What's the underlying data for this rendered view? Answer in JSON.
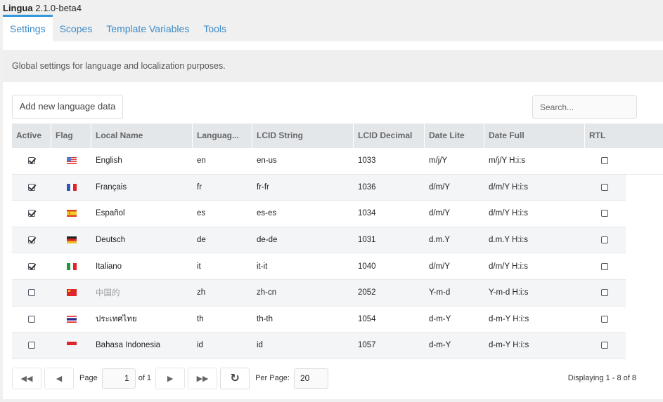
{
  "app": {
    "name": "Lingua",
    "version": "2.1.0-beta4"
  },
  "tabs": [
    {
      "label": "Settings",
      "active": true
    },
    {
      "label": "Scopes",
      "active": false
    },
    {
      "label": "Template Variables",
      "active": false
    },
    {
      "label": "Tools",
      "active": false
    }
  ],
  "description": "Global settings for language and localization purposes.",
  "toolbar": {
    "add_label": "Add new language data",
    "search_placeholder": "Search..."
  },
  "grid": {
    "columns": [
      "Active",
      "Flag",
      "Local Name",
      "Languag...",
      "LCID String",
      "LCID Decimal",
      "Date Lite",
      "Date Full",
      "RTL"
    ],
    "rows": [
      {
        "active": true,
        "flag": "us-flag-icon",
        "local_name": "English",
        "lang": "en",
        "lcid_string": "en-us",
        "lcid_decimal": "1033",
        "date_lite": "m/j/Y",
        "date_full": "m/j/Y H:i:s",
        "rtl": false
      },
      {
        "active": true,
        "flag": "fr-flag-icon",
        "local_name": "Français",
        "lang": "fr",
        "lcid_string": "fr-fr",
        "lcid_decimal": "1036",
        "date_lite": "d/m/Y",
        "date_full": "d/m/Y H:i:s",
        "rtl": false
      },
      {
        "active": true,
        "flag": "es-flag-icon",
        "local_name": "Español",
        "lang": "es",
        "lcid_string": "es-es",
        "lcid_decimal": "1034",
        "date_lite": "d/m/Y",
        "date_full": "d/m/Y H:i:s",
        "rtl": false
      },
      {
        "active": true,
        "flag": "de-flag-icon",
        "local_name": "Deutsch",
        "lang": "de",
        "lcid_string": "de-de",
        "lcid_decimal": "1031",
        "date_lite": "d.m.Y",
        "date_full": "d.m.Y H:i:s",
        "rtl": false
      },
      {
        "active": true,
        "flag": "it-flag-icon",
        "local_name": "Italiano",
        "lang": "it",
        "lcid_string": "it-it",
        "lcid_decimal": "1040",
        "date_lite": "d/m/Y",
        "date_full": "d/m/Y H:i:s",
        "rtl": false
      },
      {
        "active": false,
        "flag": "cn-flag-icon",
        "local_name": "中国的",
        "lang": "zh",
        "lcid_string": "zh-cn",
        "lcid_decimal": "2052",
        "date_lite": "Y-m-d",
        "date_full": "Y-m-d H:i:s",
        "rtl": false
      },
      {
        "active": false,
        "flag": "th-flag-icon",
        "local_name": "ประเทศไทย",
        "lang": "th",
        "lcid_string": "th-th",
        "lcid_decimal": "1054",
        "date_lite": "d-m-Y",
        "date_full": "d-m-Y H:i:s",
        "rtl": false
      },
      {
        "active": false,
        "flag": "id-flag-icon",
        "local_name": "Bahasa Indonesia",
        "lang": "id",
        "lcid_string": "id",
        "lcid_decimal": "1057",
        "date_lite": "d-m-Y",
        "date_full": "d-m-Y H:i:s",
        "rtl": false
      }
    ]
  },
  "pager": {
    "page_label": "Page",
    "page_value": "1",
    "of_label": "of 1",
    "per_page_label": "Per Page:",
    "per_page_value": "20",
    "displaying": "Displaying 1 - 8 of 8"
  },
  "colors": {
    "accent": "#3498db",
    "tab_text": "#3d8bc7",
    "header_bg": "#e4e7ea",
    "alt_row_bg": "#f4f5f7"
  }
}
